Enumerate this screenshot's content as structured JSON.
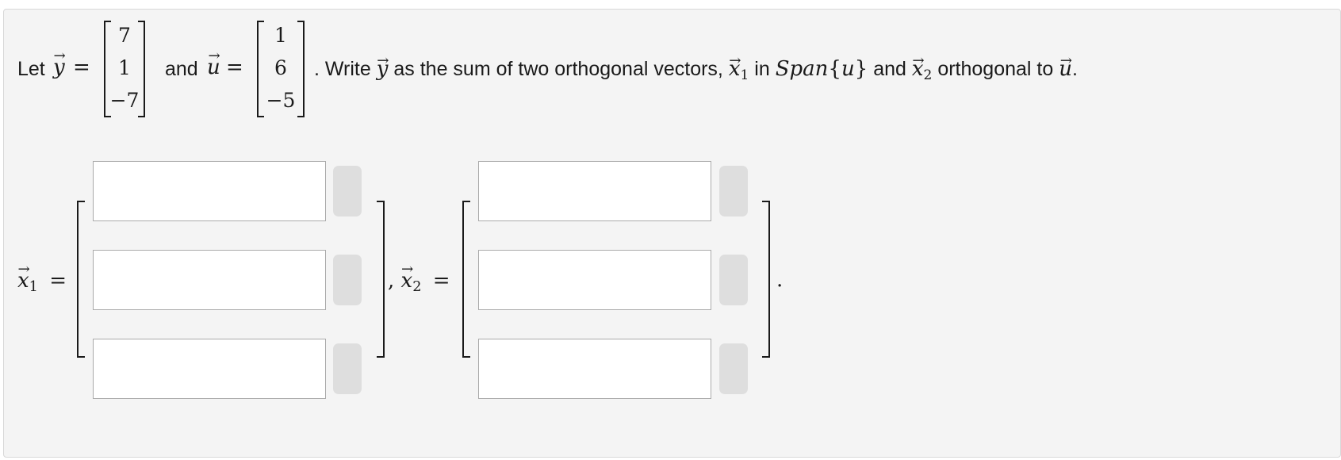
{
  "problem": {
    "let_text": "Let",
    "y_symbol": "y",
    "eq": "=",
    "y_vector": [
      "7",
      "1",
      "−7"
    ],
    "and_text": "and",
    "u_symbol": "u",
    "u_vector": [
      "1",
      "6",
      "−5"
    ],
    "sentence_1": ". Write",
    "sentence_2": "as the sum of two orthogonal vectors,",
    "x_symbol": "x",
    "sub_1": "1",
    "sub_2": "2",
    "in_text": "in",
    "span_text": "Span",
    "span_open": "{",
    "span_arg": "u",
    "span_close": "}",
    "sentence_3": "orthogonal to",
    "end_period": "."
  },
  "answer": {
    "x1_label_sub": "1",
    "x2_label_sub": "2",
    "eq": "=",
    "comma": ",",
    "period": ".",
    "x1_values": [
      "",
      "",
      ""
    ],
    "x2_values": [
      "",
      "",
      ""
    ]
  }
}
